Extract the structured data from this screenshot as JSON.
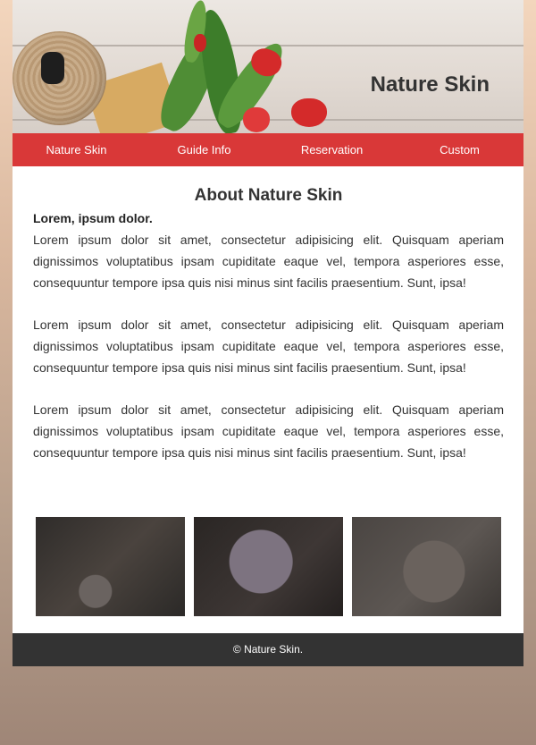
{
  "header": {
    "title": "Nature Skin"
  },
  "nav": {
    "items": [
      "Nature Skin",
      "Guide Info",
      "Reservation",
      "Custom"
    ]
  },
  "main": {
    "heading": "About Nature Skin",
    "subheading": "Lorem, ipsum dolor.",
    "paragraphs": [
      "Lorem ipsum dolor sit amet, consectetur adipisicing elit. Quisquam aperiam dignissimos voluptatibus ipsam cupiditate eaque vel, tempora asperiores esse, consequuntur tempore ipsa quis nisi minus sint facilis praesentium. Sunt, ipsa!",
      "Lorem ipsum dolor sit amet, consectetur adipisicing elit. Quisquam aperiam dignissimos voluptatibus ipsam cupiditate eaque vel, tempora asperiores esse, consequuntur tempore ipsa quis nisi minus sint facilis praesentium. Sunt, ipsa!",
      "Lorem ipsum dolor sit amet, consectetur adipisicing elit. Quisquam aperiam dignissimos voluptatibus ipsam cupiditate eaque vel, tempora asperiores esse, consequuntur tempore ipsa quis nisi minus sint facilis praesentium. Sunt, ipsa!"
    ]
  },
  "gallery": {
    "images": [
      "skincare-bottles-photo",
      "purple-flowers-photo",
      "flower-jar-photo"
    ]
  },
  "footer": {
    "text": "© Nature Skin."
  },
  "colors": {
    "nav_bg": "#d72d2d",
    "footer_bg": "#333333",
    "accent_red": "#d42a2a"
  }
}
